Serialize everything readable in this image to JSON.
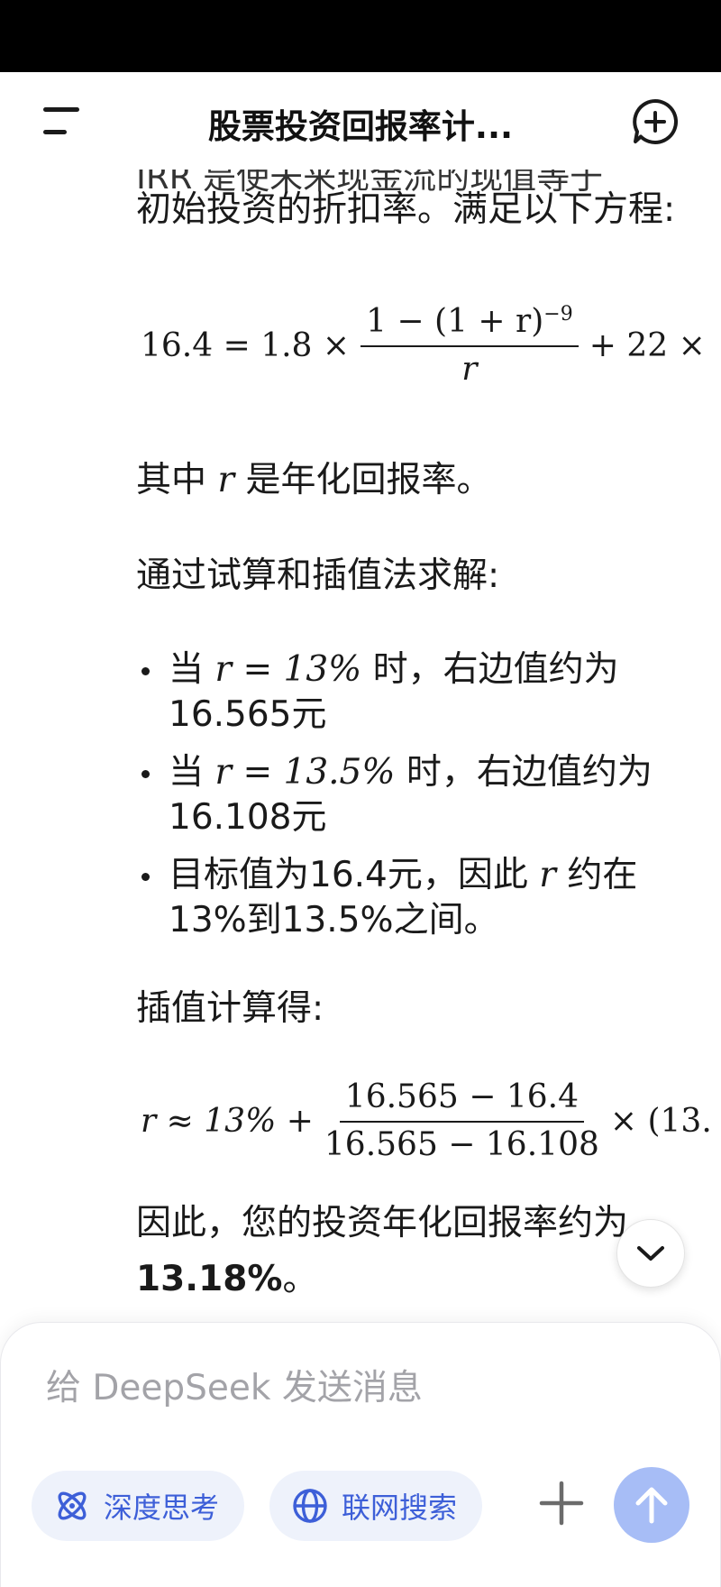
{
  "header": {
    "title": "股票投资回报率计..."
  },
  "content": {
    "cut_line": "IRR 是使未来现金流的现值等于",
    "intro": "初始投资的折扣率。满足以下方程:",
    "formula1": {
      "lhs": "16.4 = 1.8 ×",
      "numerator": "1 − (1 + r)",
      "exponent": "−9",
      "denominator": "r",
      "tail": "+ 22 ×"
    },
    "where_prefix": "其中",
    "where_var": "r",
    "where_suffix": "是年化回报率。",
    "method": "通过试算和插值法求解:",
    "bullets": [
      {
        "pre": "当",
        "math": "r = 13%",
        "post": "时，右边值约为16.565元"
      },
      {
        "pre": "当",
        "math": "r = 13.5%",
        "post": "时，右边值约为16.108元"
      },
      {
        "pre": "目标值为16.4元，因此",
        "math": "r",
        "post": "约在13%到13.5%之间。"
      }
    ],
    "interp_label": "插值计算得:",
    "formula2": {
      "lhs": "r ≈ 13% +",
      "numerator": "16.565 − 16.4",
      "denominator": "16.565 − 16.108",
      "tail": "× (13."
    },
    "conclusion_text": "因此，您的投资年化回报率约为",
    "conclusion_value": "13.18%",
    "conclusion_end": "。"
  },
  "composer": {
    "placeholder": "给 DeepSeek 发送消息",
    "deep_think_label": "深度思考",
    "web_search_label": "联网搜索"
  },
  "icons": {
    "menu": "menu-icon",
    "new_chat": "new-chat-icon",
    "scroll_down": "chevron-down-icon",
    "deep_think": "atom-icon",
    "web_search": "globe-icon",
    "plus": "plus-icon",
    "send": "arrow-up-icon"
  },
  "colors": {
    "accent": "#3d5fd8",
    "pill_bg": "#eef2fb",
    "send_bg": "#a7bdf6",
    "placeholder": "#a3a3a8"
  }
}
